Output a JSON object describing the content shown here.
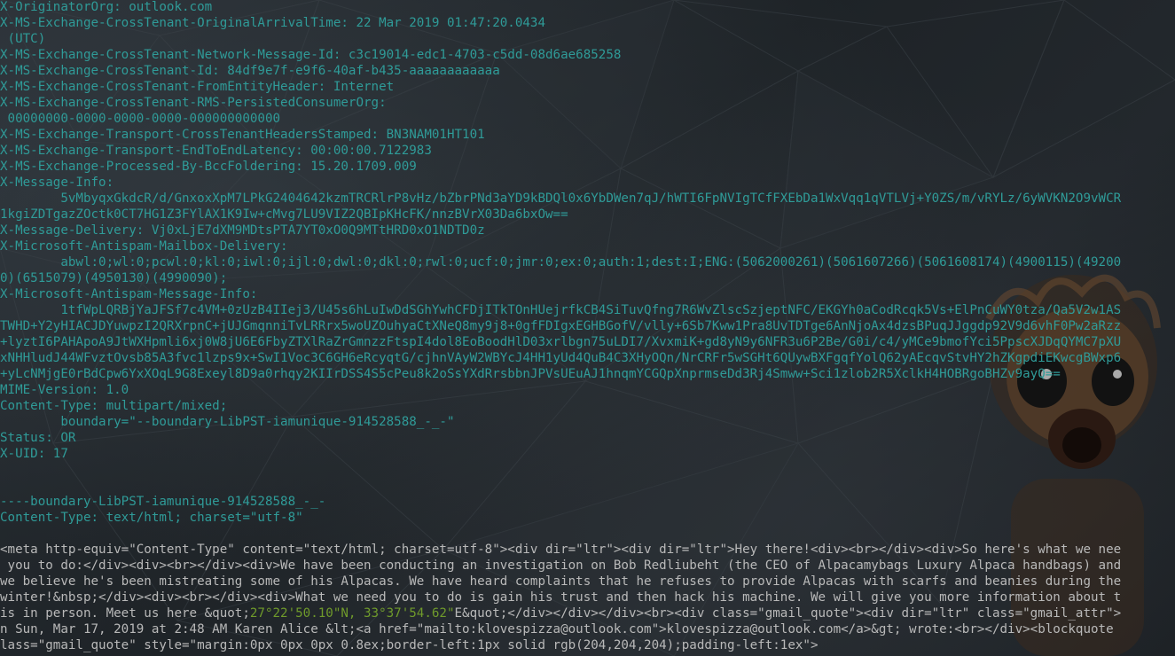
{
  "header_lines": [
    "X-OriginatorOrg: outlook.com",
    "X-MS-Exchange-CrossTenant-OriginalArrivalTime: 22 Mar 2019 01:47:20.0434",
    " (UTC)",
    "X-MS-Exchange-CrossTenant-Network-Message-Id: c3c19014-edc1-4703-c5dd-08d6ae685258",
    "X-MS-Exchange-CrossTenant-Id: 84df9e7f-e9f6-40af-b435-aaaaaaaaaaaa",
    "X-MS-Exchange-CrossTenant-FromEntityHeader: Internet",
    "X-MS-Exchange-CrossTenant-RMS-PersistedConsumerOrg:",
    " 00000000-0000-0000-0000-000000000000",
    "X-MS-Exchange-Transport-CrossTenantHeadersStamped: BN3NAM01HT101",
    "X-MS-Exchange-Transport-EndToEndLatency: 00:00:00.7122983",
    "X-MS-Exchange-Processed-By-BccFoldering: 15.20.1709.009",
    "X-Message-Info:",
    "        5vMbyqxGkdcR/d/GnxoxXpM7LPkG2404642kzmTRCRlrP8vHz/bZbrPNd3aYD9kBDQl0x6YbDWen7qJ/hWTI6FpNVIgTCfFXEbDa1WxVqq1qVTLVj+Y0ZS/m/vRYLz/6yWVKN2O9vWCR",
    "1kgiZDTgazZOctk0CT7HG1Z3FYlAX1K9Iw+cMvg7LU9VIZ2QBIpKHcFK/nnzBVrX03Da6bxOw==",
    "X-Message-Delivery: Vj0xLjE7dXM9MDtsPTA7YT0xO0Q9MTtHRD0xO1NDTD0z",
    "X-Microsoft-Antispam-Mailbox-Delivery:",
    "        abwl:0;wl:0;pcwl:0;kl:0;iwl:0;ijl:0;dwl:0;dkl:0;rwl:0;ucf:0;jmr:0;ex:0;auth:1;dest:I;ENG:(5062000261)(5061607266)(5061608174)(4900115)(49200",
    "0)(6515079)(4950130)(4990090);",
    "X-Microsoft-Antispam-Message-Info:",
    "        1tfWpLQRBjYaJFSf7c4VM+0zUzB4IIej3/U45s6hLuIwDdSGhYwhCFDjITkTOnHUejrfkCB4SiTuvQfng7R6WvZlscSzjeptNFC/EKGYh0aCodRcqk5Vs+ElPnCuWY0tza/Qa5V2w1AS",
    "TWHD+Y2yHIACJDYuwpzI2QRXrpnC+jUJGmqnniTvLRRrx5woUZOuhyaCtXNeQ8my9j8+0gfFDIgxEGHBGofV/vlly+6Sb7Kww1Pra8UvTDTge6AnNjoAx4dzsBPuqJJggdp92V9d6vhF0Pw2aRzz",
    "+lyztI6PAHApoA9JtWXHpmli6xj0W8jU6E6FbyZTXlRaZrGmnzzFtspI4dol8EoBoodHlD03xrlbgn75uLDI7/XvxmiK+gd8yN9y6NFR3u6P2Be/G0i/c4/yMCe9bmofYci5PpscXJDqQYMC7pXU",
    "xNHHludJ44WFvztOvsb85A3fvc1lzps9x+SwI1Voc3C6GH6eRcyqtG/cjhnVAyW2WBYcJ4HH1yUd4QuB4C3XHyOQn/NrCRFr5wSGHt6QUywBXFgqfYolQ62yAEcqvStvHY2hZKgpdiEKwcgBWxp6",
    "+yLcNMjgE0rBdCpw6YxXOqL9G8Exeyl8D9a0rhqy2KIIrDSS4S5cPeu8k2oSsYXdRrsbbnJPVsUEuAJ1hnqmYCGQpXnprmseDd3Rj4Smww+Sci1zlob2R5XclkH4HOBRgoBHZv9ayQ==",
    "MIME-Version: 1.0",
    "Content-Type: multipart/mixed;",
    "        boundary=\"--boundary-LibPST-iamunique-914528588_-_-\"",
    "Status: OR",
    "X-UID: 17",
    "",
    "",
    "----boundary-LibPST-iamunique-914528588_-_-",
    "Content-Type: text/html; charset=\"utf-8\"",
    ""
  ],
  "body_lines": [
    {
      "pre": "<meta http-equiv=\"Content-Type\" content=\"text/html; charset=utf-8\"><div dir=\"ltr\"><div dir=\"ltr\">Hey there!<div><br></div><div>So here's what we nee",
      "hl": "",
      "post": ""
    },
    {
      "pre": " you to do:</div><div><br></div><div>We have been conducting an investigation on Bob Redliubeht (the CEO of Alpacamybags Luxury Alpaca handbags) and",
      "hl": "",
      "post": ""
    },
    {
      "pre": "we believe he's been mistreating some of his Alpacas. We have heard complaints that he refuses to provide Alpacas with scarfs and beanies during the",
      "hl": "",
      "post": ""
    },
    {
      "pre": "winter!&nbsp;</div><div><br></div><div>What we need you to do is gain his trust and then hack his machine. We will give you more information about t",
      "hl": "",
      "post": ""
    },
    {
      "pre": "is in person. Meet us here &quot;",
      "hl": "27°22'50.10\"N, 33°37'54.62\"",
      "post": "E&quot;</div></div></div><br><div class=\"gmail_quote\"><div dir=\"ltr\" class=\"gmail_attr\">"
    },
    {
      "pre": "n Sun, Mar 17, 2019 at 2:48 AM Karen Alice &lt;<a href=\"mailto:klovespizza@outlook.com\">klovespizza@outlook.com</a>&gt; wrote:<br></div><blockquote",
      "hl": "",
      "post": ""
    },
    {
      "pre": "lass=\"gmail_quote\" style=\"margin:0px 0px 0px 0.8ex;border-left:1px solid rgb(204,204,204);padding-left:1ex\">",
      "hl": "",
      "post": ""
    }
  ],
  "colors": {
    "header_text": "#2f9b98",
    "body_text": "#b9b9b9",
    "highlight": "#6f9a2b",
    "background": "#1c2024"
  }
}
